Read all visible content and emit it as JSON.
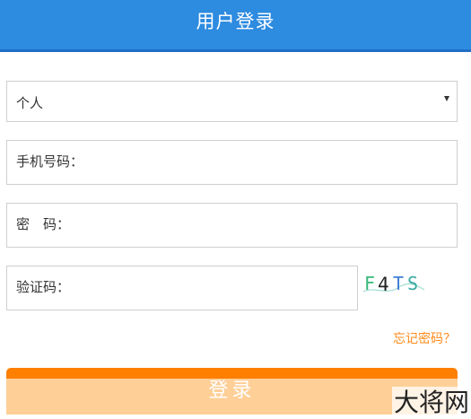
{
  "header": {
    "title": "用户登录",
    "background_color": "#2d8be0"
  },
  "form": {
    "account_type": {
      "selected": "个人",
      "icon": "dropdown-arrow-icon"
    },
    "phone": {
      "label": "手机号码：",
      "value": ""
    },
    "password": {
      "label": "密　码：",
      "value": ""
    },
    "captcha": {
      "label": "验证码：",
      "value": "",
      "image_text": "F4TS"
    },
    "forgot_password": "忘记密码？",
    "submit_label": "登录",
    "accent_color": "#ff7f00"
  },
  "watermark": {
    "text": "大将网"
  }
}
